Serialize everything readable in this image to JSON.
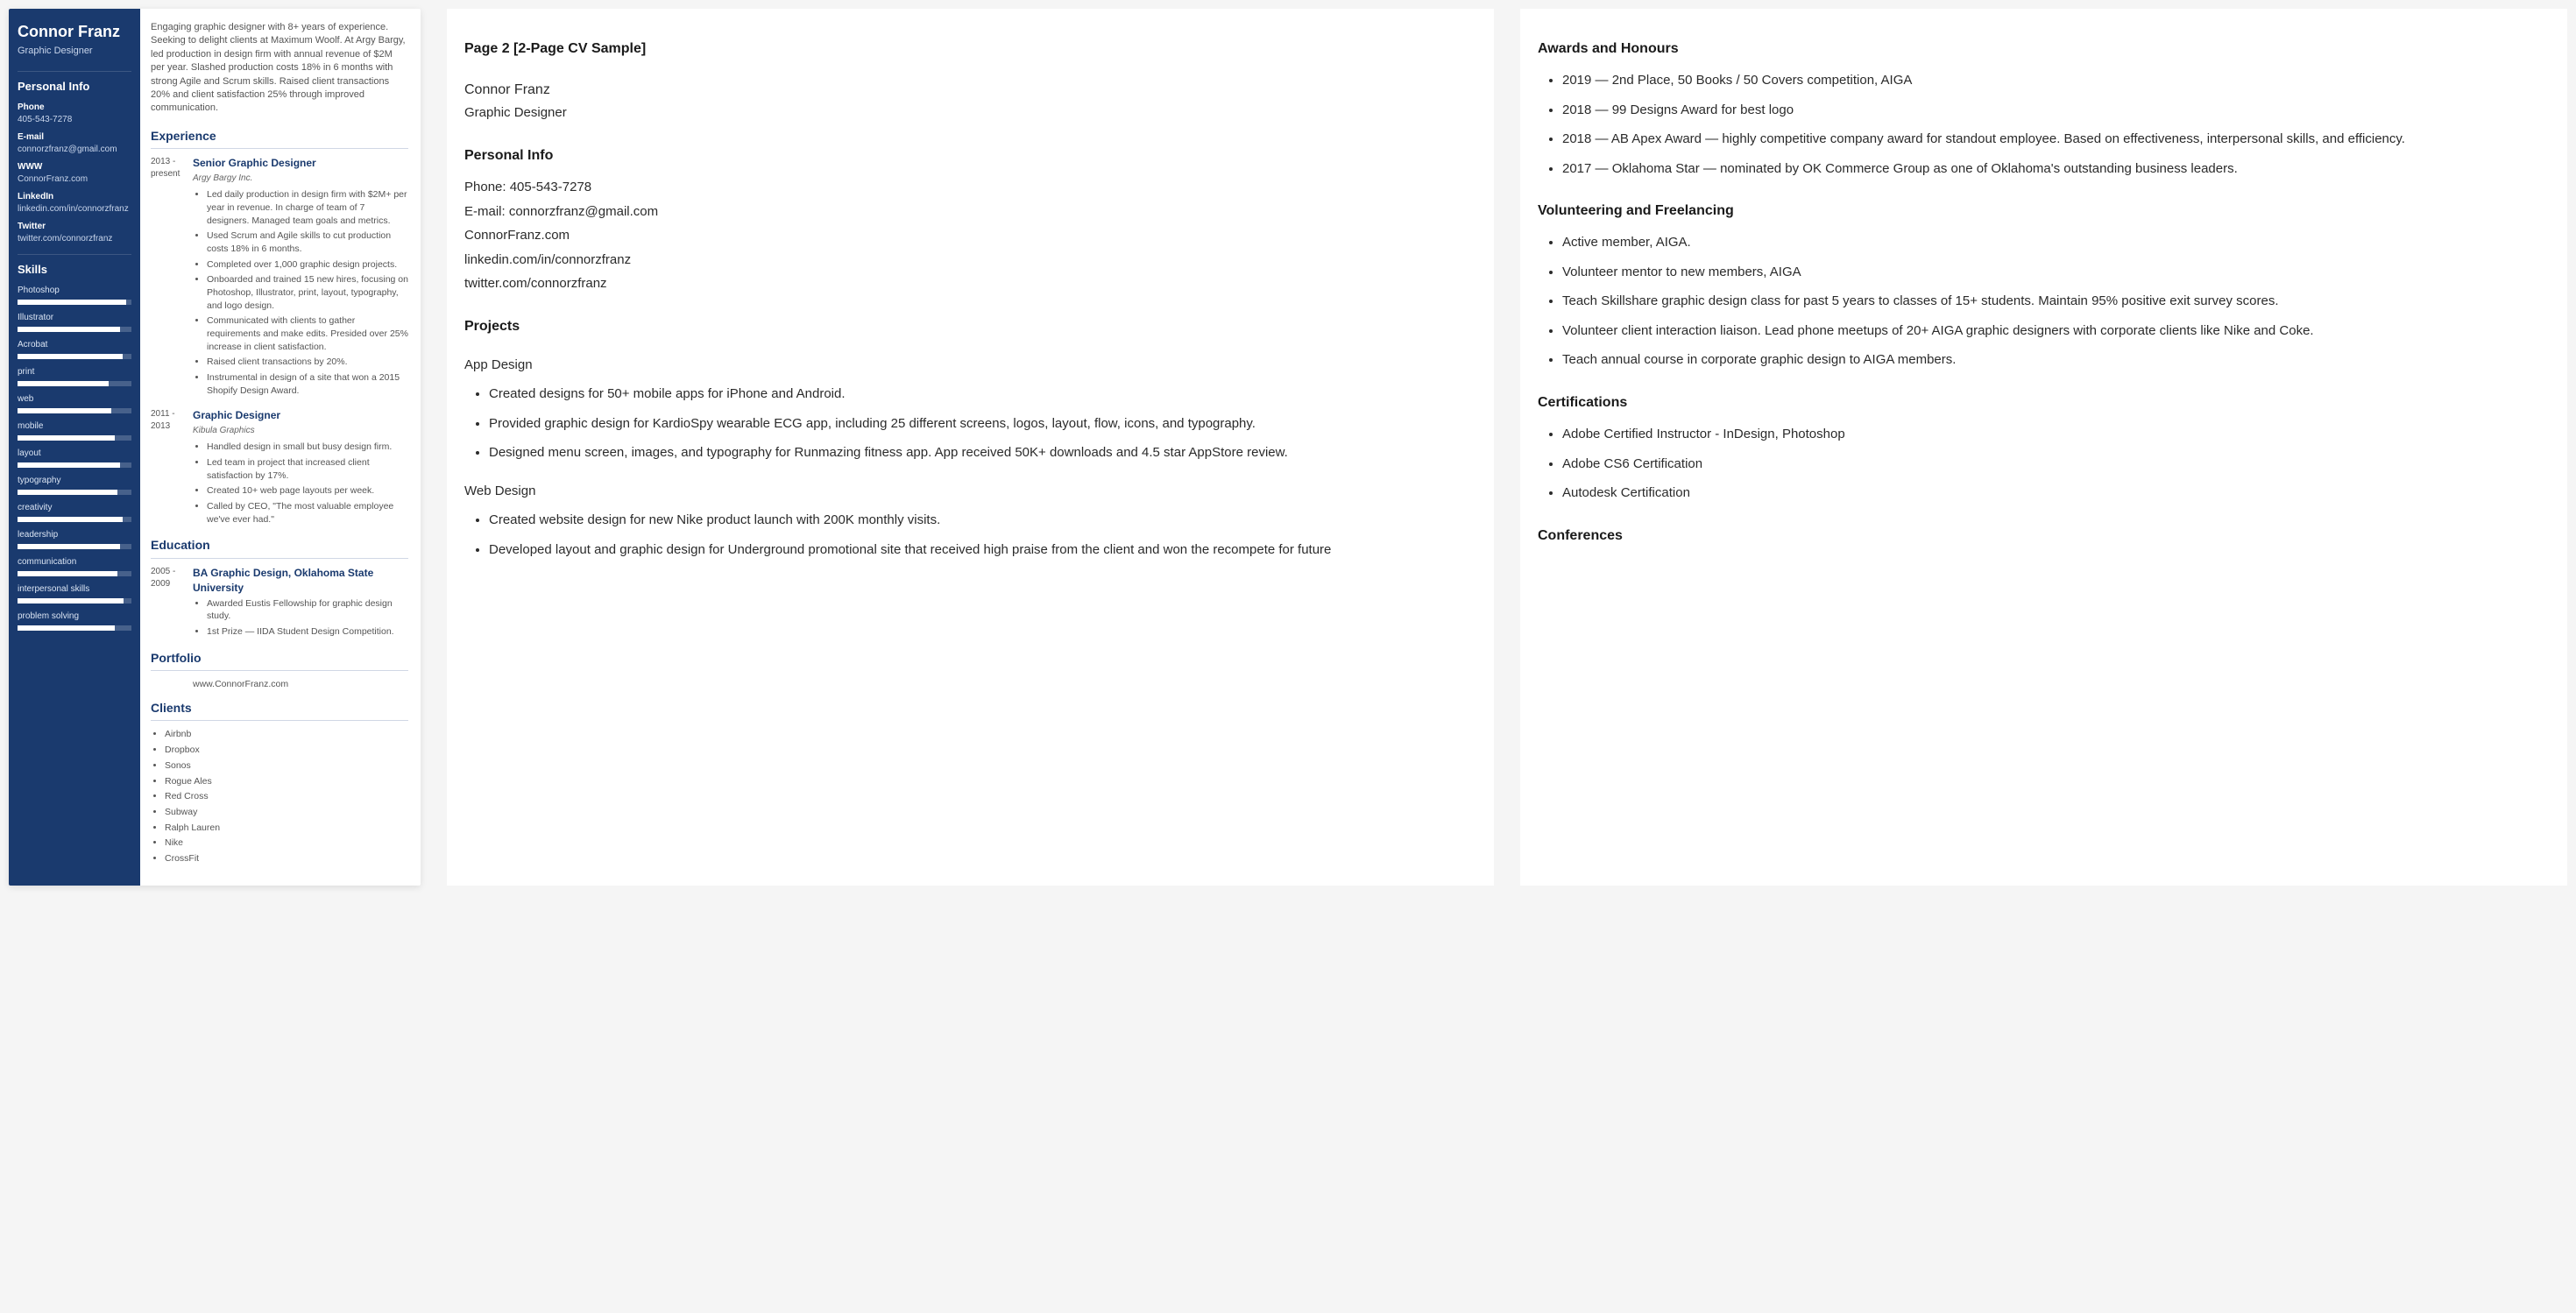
{
  "resume": {
    "name": "Connor Franz",
    "role": "Graphic Designer",
    "personal_info_heading": "Personal Info",
    "contacts": [
      {
        "label": "Phone",
        "value": "405-543-7278"
      },
      {
        "label": "E-mail",
        "value": "connorzfranz@gmail.com"
      },
      {
        "label": "WWW",
        "value": "ConnorFranz.com"
      },
      {
        "label": "LinkedIn",
        "value": "linkedin.com/in/connorzfranz"
      },
      {
        "label": "Twitter",
        "value": "twitter.com/connorzfranz"
      }
    ],
    "skills_heading": "Skills",
    "skills": [
      {
        "name": "Photoshop",
        "level": 95
      },
      {
        "name": "Illustrator",
        "level": 90
      },
      {
        "name": "Acrobat",
        "level": 92
      },
      {
        "name": "print",
        "level": 80
      },
      {
        "name": "web",
        "level": 82
      },
      {
        "name": "mobile",
        "level": 85
      },
      {
        "name": "layout",
        "level": 90
      },
      {
        "name": "typography",
        "level": 88
      },
      {
        "name": "creativity",
        "level": 92
      },
      {
        "name": "leadership",
        "level": 90
      },
      {
        "name": "communication",
        "level": 88
      },
      {
        "name": "interpersonal skills",
        "level": 93
      },
      {
        "name": "problem solving",
        "level": 85
      }
    ],
    "summary": "Engaging graphic designer with 8+ years of experience. Seeking to delight clients at Maximum Woolf. At Argy Bargy, led production in design firm with annual revenue of $2M per year. Slashed production costs 18% in 6 months with strong Agile and Scrum skills. Raised client transactions 20% and client satisfaction 25% through improved communication.",
    "experience_heading": "Experience",
    "jobs": [
      {
        "dates": "2013 - present",
        "title": "Senior Graphic Designer",
        "company": "Argy Bargy Inc.",
        "bullets": [
          "Led daily production in design firm with $2M+ per year in revenue. In charge of team of 7 designers. Managed team goals and metrics.",
          "Used Scrum and Agile skills to cut production costs 18% in 6 months.",
          "Completed over 1,000 graphic design projects.",
          "Onboarded and trained 15 new hires, focusing on Photoshop, Illustrator, print, layout, typography, and logo design.",
          "Communicated with clients to gather requirements and make edits. Presided over 25% increase in client satisfaction.",
          "Raised client transactions by 20%.",
          "Instrumental in design of a site that won a 2015 Shopify Design Award."
        ]
      },
      {
        "dates": "2011 - 2013",
        "title": "Graphic Designer",
        "company": "Kibula Graphics",
        "bullets": [
          "Handled design in small but busy design firm.",
          "Led team in project that increased client satisfaction by 17%.",
          "Created 10+ web page layouts per week.",
          "Called by CEO, \"The most valuable employee we've ever had.\""
        ]
      }
    ],
    "education_heading": "Education",
    "education": {
      "dates": "2005 - 2009",
      "title": "BA Graphic Design, Oklahoma State University",
      "bullets": [
        "Awarded Eustis Fellowship for graphic design study.",
        "1st Prize — IIDA Student Design Competition."
      ]
    },
    "portfolio_heading": "Portfolio",
    "portfolio": "www.ConnorFranz.com",
    "clients_heading": "Clients",
    "clients": [
      "Airbnb",
      "Dropbox",
      "Sonos",
      "Rogue Ales",
      "Red Cross",
      "Subway",
      "Ralph Lauren",
      "Nike",
      "CrossFit"
    ]
  },
  "page2": {
    "title": "Page 2 [2-Page CV Sample]",
    "name": "Connor Franz",
    "role": "Graphic Designer",
    "personal_info_heading": "Personal Info",
    "contacts": [
      "Phone: 405-543-7278",
      "E-mail: connorzfranz@gmail.com",
      "ConnorFranz.com",
      "linkedin.com/in/connorzfranz",
      "twitter.com/connorzfranz"
    ],
    "projects_heading": "Projects",
    "app_design_heading": "App Design",
    "app_design": [
      "Created designs for 50+ mobile apps for iPhone and Android.",
      "Provided graphic design for KardioSpy wearable ECG app, including 25 different screens, logos, layout, flow, icons, and typography.",
      "Designed menu screen, images, and typography for Runmazing fitness app. App received 50K+ downloads and 4.5 star AppStore review."
    ],
    "web_design_heading": "Web Design",
    "web_design": [
      "Created website design for new Nike product launch with 200K monthly visits.",
      "Developed layout and graphic design for Underground promotional site that received high praise from the client and won the recompete for future"
    ]
  },
  "page2b": {
    "awards_heading": "Awards and Honours",
    "awards": [
      "2019 — 2nd Place, 50 Books / 50 Covers competition, AIGA",
      "2018 — 99 Designs Award for best logo",
      "2018 — AB Apex Award — highly competitive company award for standout employee. Based on effectiveness, interpersonal skills, and efficiency.",
      "2017 — Oklahoma Star — nominated by OK Commerce Group as one of Oklahoma's outstanding business leaders."
    ],
    "volunteer_heading": "Volunteering and Freelancing",
    "volunteer": [
      "Active member, AIGA.",
      "Volunteer mentor to new members, AIGA",
      "Teach Skillshare graphic design class for past 5 years to classes of 15+ students. Maintain 95% positive exit survey scores.",
      "Volunteer client interaction liaison. Lead phone meetups of 20+ AIGA graphic designers with corporate clients like Nike and Coke.",
      "Teach annual course in corporate graphic design to AIGA members."
    ],
    "certs_heading": "Certifications",
    "certs": [
      "Adobe Certified Instructor - InDesign, Photoshop",
      "Adobe CS6 Certification",
      "Autodesk Certification"
    ],
    "conf_heading": "Conferences"
  }
}
